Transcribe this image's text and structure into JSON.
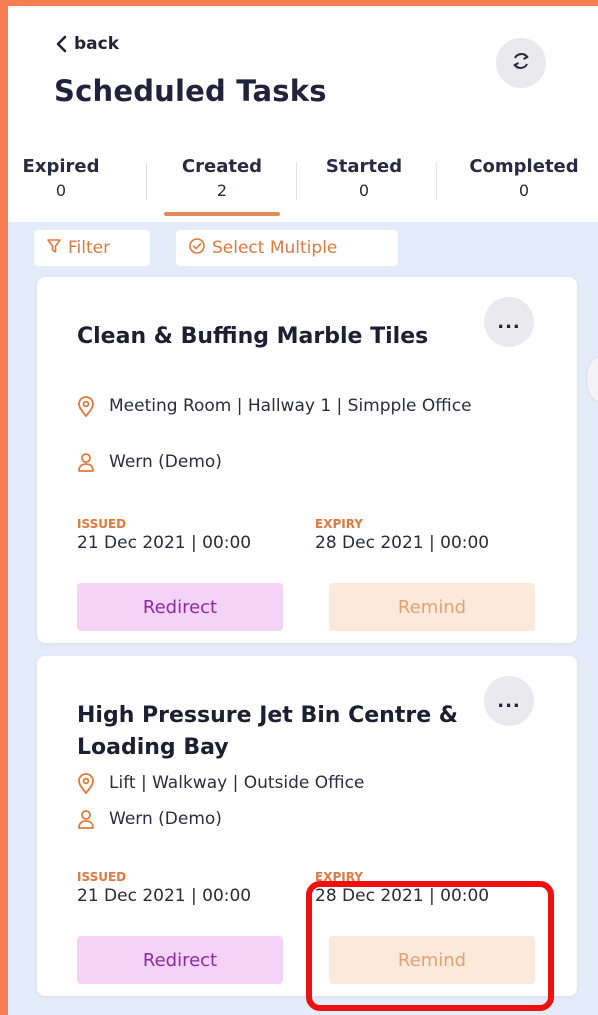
{
  "header": {
    "back_label": "back",
    "title": "Scheduled Tasks"
  },
  "tabs": [
    {
      "label": "Expired",
      "count": "0",
      "active": false
    },
    {
      "label": "Created",
      "count": "2",
      "active": true
    },
    {
      "label": "Started",
      "count": "0",
      "active": false
    },
    {
      "label": "Completed",
      "count": "0",
      "active": false
    }
  ],
  "toolbar": {
    "filter_label": "Filter",
    "select_multiple_label": "Select Multiple"
  },
  "tasks": [
    {
      "title": "Clean & Buffing Marble Tiles",
      "location": "Meeting Room  |  Hallway 1  |  Simpple Office",
      "assignee": "Wern (Demo)",
      "issued_label": "ISSUED",
      "issued": "21 Dec 2021 | 00:00",
      "expiry_label": "EXPIRY",
      "expiry": "28 Dec 2021 | 00:00",
      "redirect_label": "Redirect",
      "remind_label": "Remind",
      "more_label": "..."
    },
    {
      "title": "High Pressure Jet Bin Centre & Loading Bay",
      "location": "Lift  |  Walkway  |  Outside Office",
      "assignee": "Wern (Demo)",
      "issued_label": "ISSUED",
      "issued": "21 Dec 2021 | 00:00",
      "expiry_label": "EXPIRY",
      "expiry": "28 Dec 2021 | 00:00",
      "redirect_label": "Redirect",
      "remind_label": "Remind",
      "more_label": "..."
    }
  ],
  "colors": {
    "accent": "#e0793f",
    "frame": "#f47e52",
    "background": "#e4ebf9",
    "redirect_bg": "#f5d2f7",
    "redirect_text": "#8a2ca0",
    "remind_bg": "#fbeadc",
    "remind_text": "#e4a173",
    "highlight": "#ef1010"
  },
  "icons": {
    "back": "chevron-left-icon",
    "refresh": "refresh-icon",
    "filter": "filter-icon",
    "select_multiple": "check-circle-icon",
    "location": "location-pin-icon",
    "assignee": "user-icon",
    "more": "more-dots-icon"
  }
}
